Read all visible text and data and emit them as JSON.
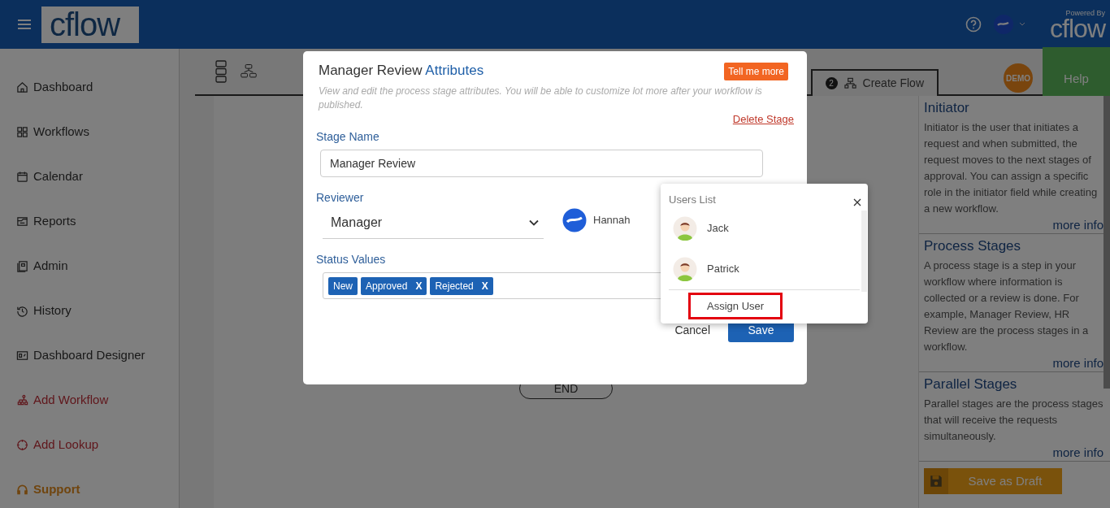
{
  "header": {
    "logo": "cflow",
    "powered_by": "Powered By",
    "powered_logo": "cflow"
  },
  "sidebar": {
    "items": [
      {
        "label": "Dashboard",
        "kind": "nav"
      },
      {
        "label": "Workflows",
        "kind": "nav"
      },
      {
        "label": "Calendar",
        "kind": "nav"
      },
      {
        "label": "Reports",
        "kind": "nav"
      },
      {
        "label": "Admin",
        "kind": "nav"
      },
      {
        "label": "History",
        "kind": "nav"
      },
      {
        "label": "Dashboard Designer",
        "kind": "nav"
      },
      {
        "label": "Add Workflow",
        "kind": "action"
      },
      {
        "label": "Add Lookup",
        "kind": "action"
      },
      {
        "label": "Support",
        "kind": "support"
      }
    ]
  },
  "toolbar": {
    "tab": {
      "badge": "2",
      "label": "Create Flow"
    },
    "demo_badge": "DEMO",
    "help": "Help"
  },
  "canvas": {
    "end_node": "END"
  },
  "info_panel": {
    "sections": [
      {
        "title": "Initiator",
        "text": "Initiator is the user that initiates a request and when submitted, the request moves to the next stages of approval. You can assign a specific role in the initiator field while creating a new workflow.",
        "link": "more info"
      },
      {
        "title": "Process Stages",
        "text": "A process stage is a step in your workflow where information is collected or a review is done. For example, Manager Review, HR Review are the process stages in a workflow.",
        "link": "more info"
      },
      {
        "title": "Parallel Stages",
        "text": "Parallel stages are the process stages that will receive the requests simultaneously.",
        "link": "more info"
      }
    ],
    "save_draft": "Save as Draft"
  },
  "modal": {
    "title": "Manager Review",
    "title_accent": "Attributes",
    "tell_me_more": "Tell me more",
    "description": "View and edit the process stage attributes. You will be able to customize lot more after your workflow is published.",
    "delete_link": "Delete Stage",
    "stage_name_label": "Stage Name",
    "stage_name_value": "Manager Review",
    "reviewer_label": "Reviewer",
    "reviewer_value": "Manager",
    "reviewer_user": "Hannah",
    "status_label": "Status Values",
    "status_values": [
      {
        "label": "New",
        "removable": false
      },
      {
        "label": "Approved",
        "removable": true,
        "remove": "X"
      },
      {
        "label": "Rejected",
        "removable": true,
        "remove": "X"
      }
    ],
    "cancel": "Cancel",
    "save": "Save"
  },
  "users_popup": {
    "title": "Users List",
    "users": [
      {
        "name": "Jack"
      },
      {
        "name": "Patrick"
      }
    ],
    "assign": "Assign User",
    "assign_highlighted": true
  }
}
